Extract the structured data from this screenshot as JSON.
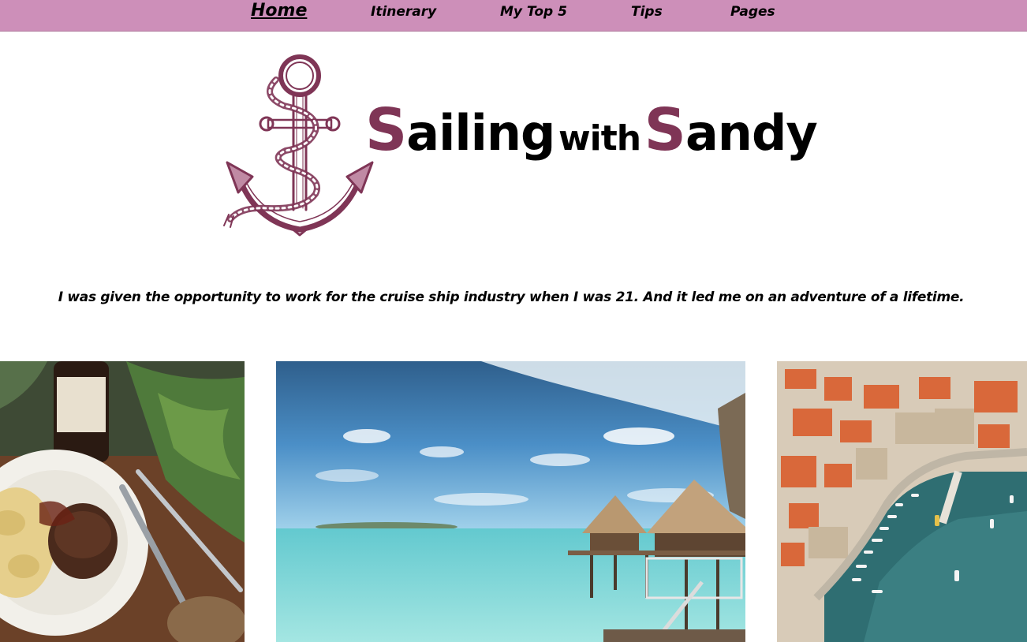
{
  "nav": {
    "items": [
      {
        "label": "Home",
        "active": true
      },
      {
        "label": "Itinerary",
        "active": false
      },
      {
        "label": "My Top 5",
        "active": false
      },
      {
        "label": "Tips",
        "active": false
      },
      {
        "label": "Pages",
        "active": false
      }
    ],
    "background": "#cd8fb9"
  },
  "header": {
    "title_parts": {
      "s1": "S",
      "w1": "ailing",
      "w2": "with",
      "s2": "S",
      "w3": "andy"
    },
    "accent_color": "#7f3556",
    "logo_icon": "anchor-icon"
  },
  "tagline": "I was given the opportunity to work for the cruise ship industry when I was 21. And it led me on an adventure of a lifetime.",
  "gallery": [
    {
      "name": "steak-dinner-photo"
    },
    {
      "name": "overwater-bungalows-photo"
    },
    {
      "name": "harbor-aerial-photo"
    }
  ]
}
